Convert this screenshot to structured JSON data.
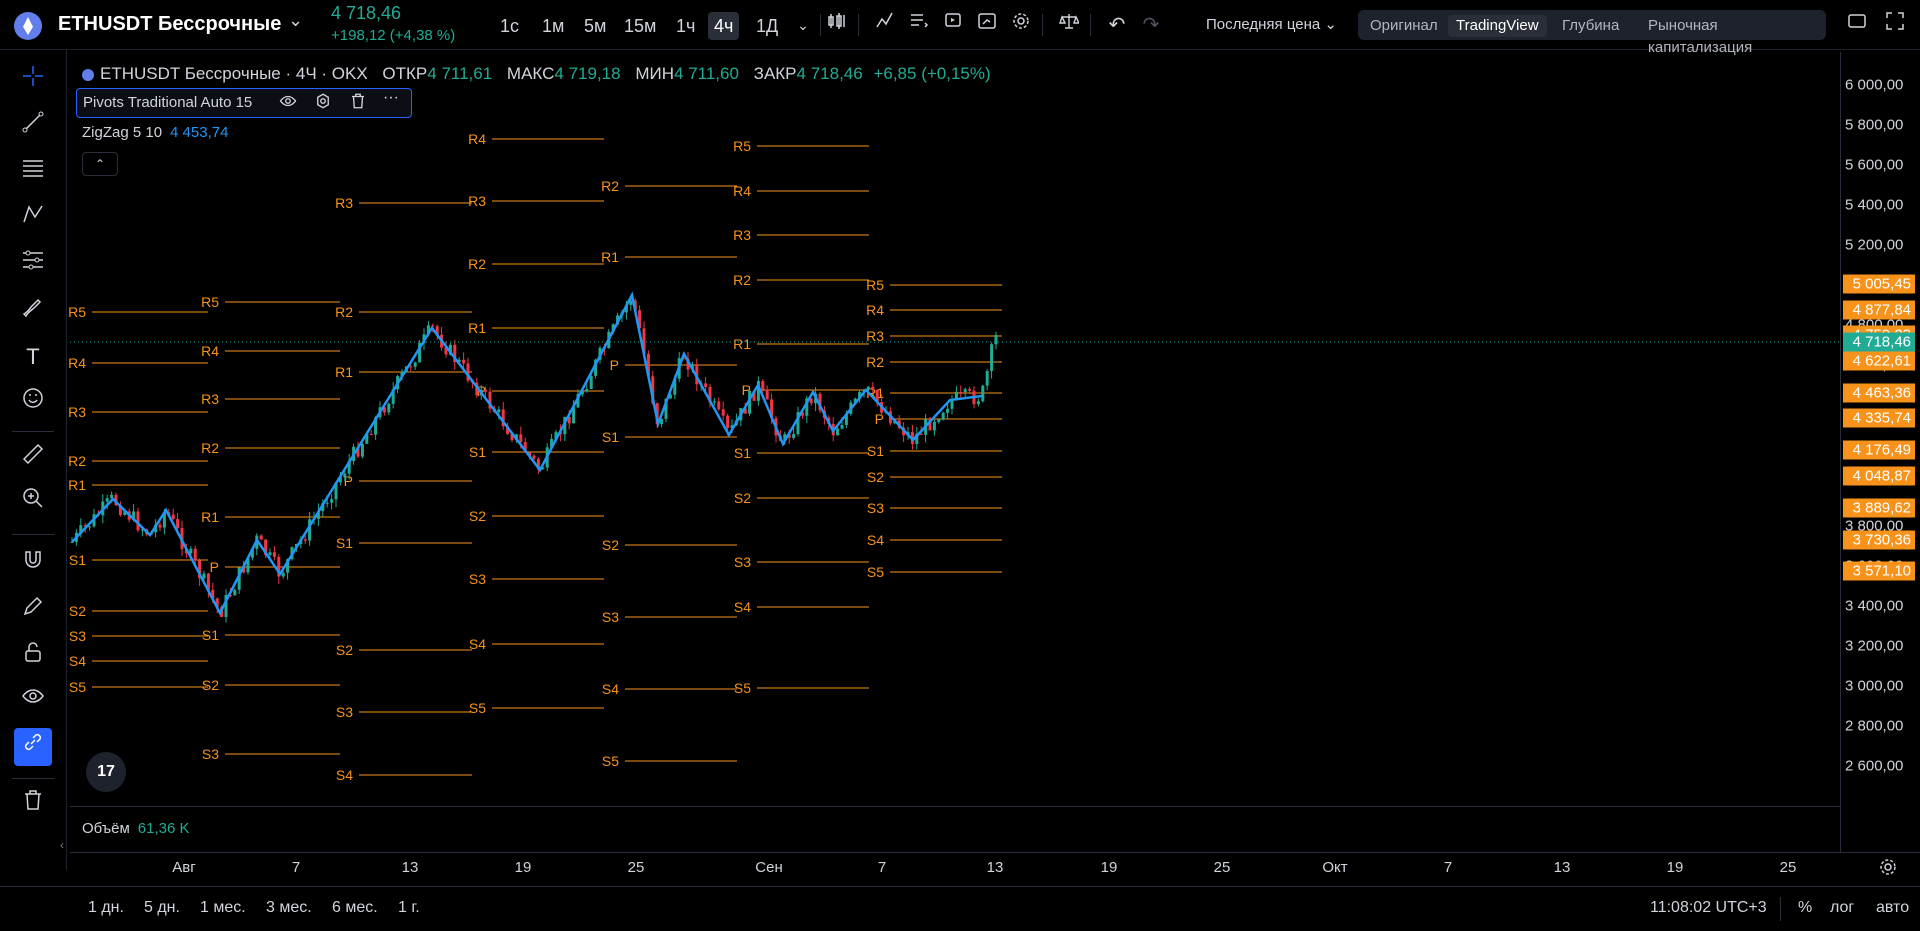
{
  "header": {
    "symbol": "ETHUSDT Бессрочные",
    "price": "4 718,46",
    "change": "+198,12 (+4,38 %)",
    "timeframes": [
      "1с",
      "1м",
      "5м",
      "15м",
      "1ч",
      "4ч",
      "1Д"
    ],
    "active_timeframe": "4ч",
    "price_type": "Последняя цена",
    "view_tabs": [
      "Оригинал",
      "TradingView",
      "Глубина",
      "Рыночная капитализация"
    ],
    "active_view": "TradingView"
  },
  "legend": {
    "title": "ETHUSDT Бессрочные · 4Ч · OKX",
    "open_label": "ОТКР",
    "open": "4 711,61",
    "high_label": "МАКС",
    "high": "4 719,18",
    "low_label": "МИН",
    "low": "4 711,60",
    "close_label": "ЗАКР",
    "close": "4 718,46",
    "change": "+6,85 (+0,15%)"
  },
  "indicators": {
    "pivots": "Pivots Traditional Auto 15",
    "zigzag_label": "ZigZag 5 10",
    "zigzag_value": "4 453,74",
    "volume_label": "Объём",
    "volume_value": "61,36 K"
  },
  "price_axis": [
    "6 000,00",
    "5 800,00",
    "5 600,00",
    "5 400,00",
    "5 200,00",
    "4 800,00",
    "4 600,00",
    "3 800,00",
    "3 600,00",
    "3 400,00",
    "3 200,00",
    "3 000,00",
    "2 800,00",
    "2 600,00"
  ],
  "price_badges": [
    {
      "text": "5 005,45",
      "price": 5005.45
    },
    {
      "text": "4 877,84",
      "price": 4877.84
    },
    {
      "text": "4 750,23",
      "price": 4750.23
    },
    {
      "text": "4 718,46",
      "price": 4718.46,
      "current": true
    },
    {
      "text": "4 622,61",
      "price": 4622.61
    },
    {
      "text": "4 463,36",
      "price": 4463.36
    },
    {
      "text": "4 335,74",
      "price": 4335.74
    },
    {
      "text": "4 176,49",
      "price": 4176.49
    },
    {
      "text": "4 048,87",
      "price": 4048.87
    },
    {
      "text": "3 889,62",
      "price": 3889.62
    },
    {
      "text": "3 730,36",
      "price": 3730.36
    },
    {
      "text": "3 571,10",
      "price": 3571.1
    }
  ],
  "time_axis": [
    "Авг",
    "7",
    "13",
    "19",
    "25",
    "Сен",
    "7",
    "13",
    "19",
    "25",
    "Окт",
    "7",
    "13",
    "19",
    "25"
  ],
  "bottom": {
    "ranges": [
      "1 дн.",
      "5 дн.",
      "1 мес.",
      "3 мес.",
      "6 мес.",
      "1 г."
    ],
    "clock": "11:08:02 UTC+3",
    "percent": "%",
    "log": "лог",
    "auto": "авто"
  },
  "colors": {
    "up": "#22ab94",
    "down": "#f23645",
    "pivot": "#f7931a",
    "zigzag": "#2196f3",
    "accent": "#2962ff"
  }
}
